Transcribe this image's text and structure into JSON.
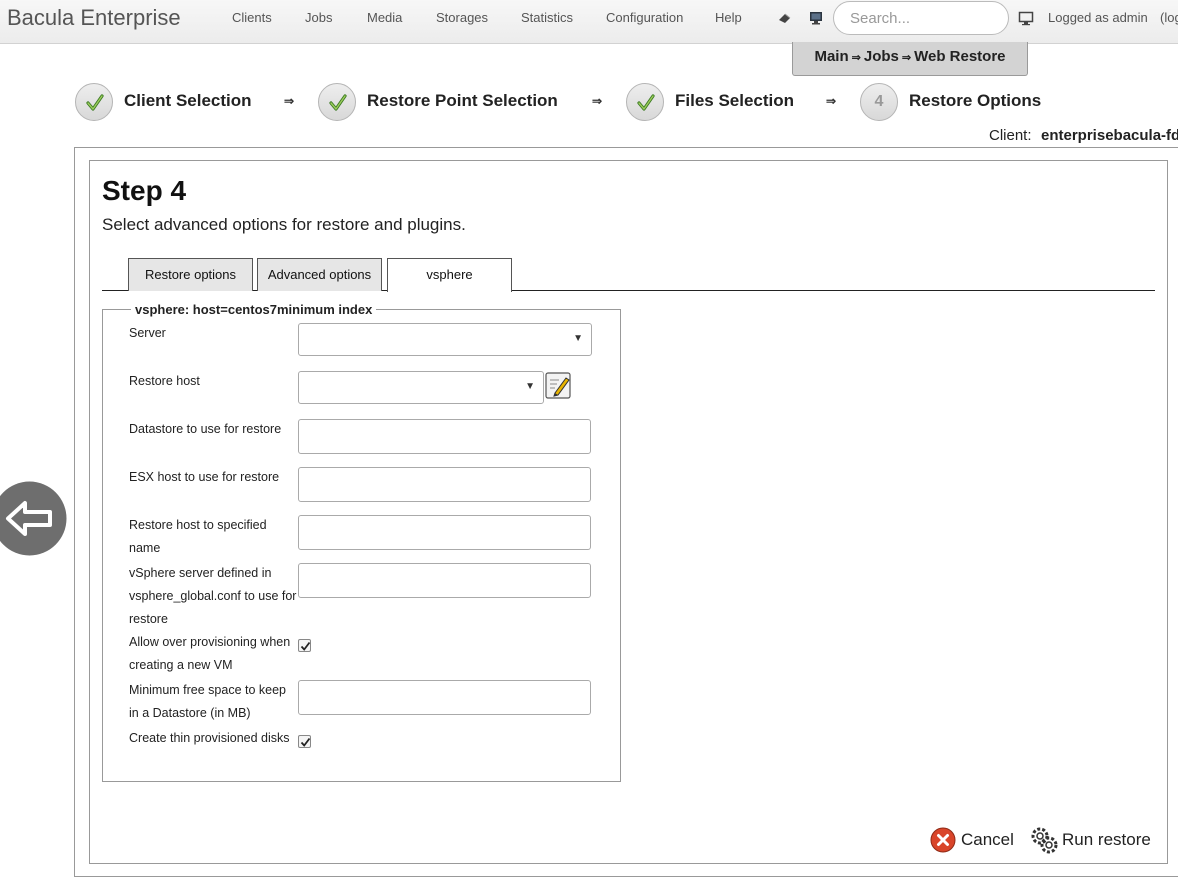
{
  "header": {
    "brand": "Bacula Enterprise",
    "nav": [
      "Clients",
      "Jobs",
      "Media",
      "Storages",
      "Statistics",
      "Configuration",
      "Help"
    ],
    "search_placeholder": "Search...",
    "logged_as": "Logged as admin",
    "logout": "(log"
  },
  "breadcrumb": {
    "items": [
      "Main",
      "Jobs",
      "Web Restore"
    ],
    "separator": "⇒"
  },
  "wizard": {
    "steps": [
      {
        "label": "Client Selection",
        "status": "done"
      },
      {
        "label": "Restore Point Selection",
        "status": "done"
      },
      {
        "label": "Files Selection",
        "status": "done"
      },
      {
        "label": "Restore Options",
        "status": "current",
        "number": "4"
      }
    ],
    "arrow": "⇒"
  },
  "client": {
    "label": "Client:",
    "value": "enterprisebacula-fd"
  },
  "main": {
    "title": "Step 4",
    "description": "Select advanced options for restore and plugins.",
    "tabs": [
      "Restore options",
      "Advanced options",
      "vsphere"
    ],
    "active_tab": "vsphere"
  },
  "vsphere": {
    "legend": "vsphere: host=centos7minimum index",
    "fields": {
      "server": {
        "label": "Server",
        "value": ""
      },
      "restore_host": {
        "label": "Restore host",
        "value": ""
      },
      "datastore": {
        "label": "Datastore to use for restore",
        "value": ""
      },
      "esx_host": {
        "label": "ESX host to use for restore",
        "value": ""
      },
      "restore_host_name": {
        "label": "Restore host to specified name",
        "value": ""
      },
      "vsphere_server": {
        "label": "vSphere server defined in vsphere_global.conf to use for restore",
        "value": ""
      },
      "allow_over_provisioning": {
        "label": "Allow over provisioning when creating a new VM",
        "checked": true
      },
      "min_free_space": {
        "label": "Minimum free space to keep in a Datastore (in MB)",
        "value": ""
      },
      "thin_disks": {
        "label": "Create thin provisioned disks",
        "checked": true
      }
    }
  },
  "actions": {
    "cancel": "Cancel",
    "run": "Run restore"
  },
  "colors": {
    "cancel_red": "#d9452a",
    "topbar_bg": "#efefef",
    "breadcrumb_bg": "#d3d3d3"
  }
}
